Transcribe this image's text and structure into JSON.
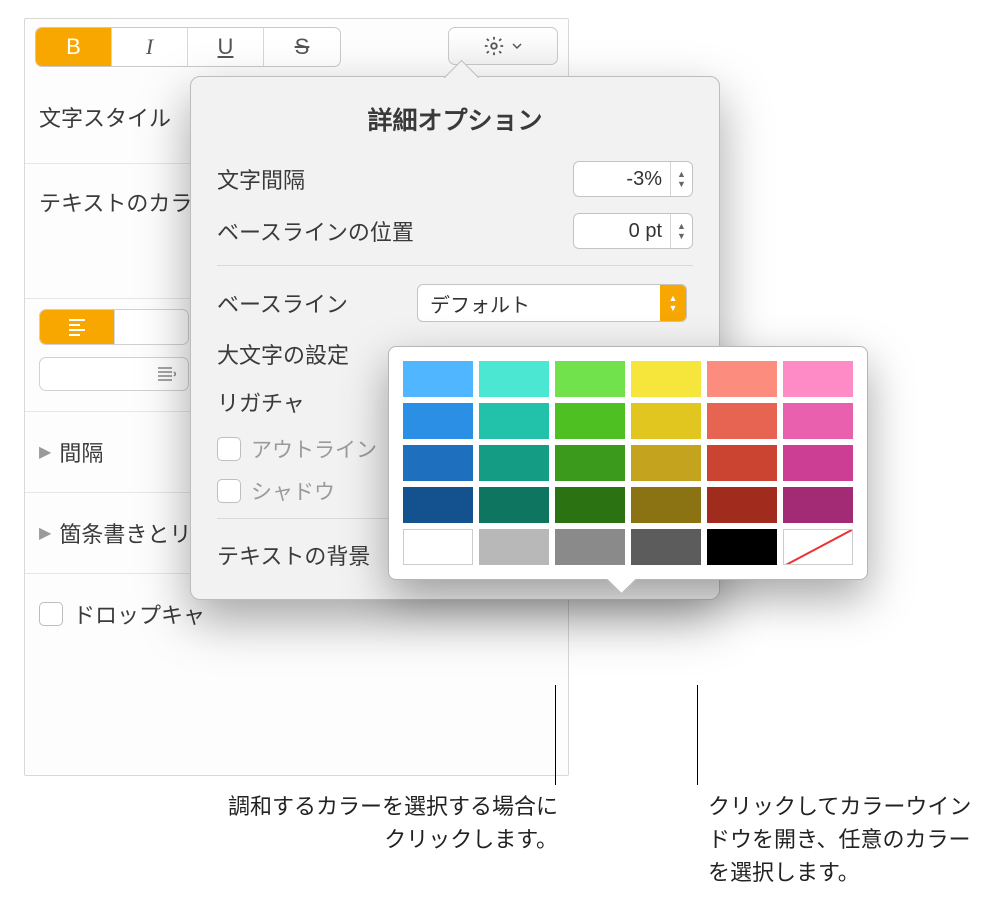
{
  "toolbar": {
    "bold": "B",
    "italic": "I",
    "underline": "U",
    "strike": "S"
  },
  "sidebar": {
    "char_style": "文字スタイル",
    "text_color": "テキストのカラー",
    "spacing": "間隔",
    "bullets": "箇条書きとリ",
    "dropcap": "ドロップキャ"
  },
  "popover": {
    "title": "詳細オプション",
    "char_spacing_label": "文字間隔",
    "char_spacing_value": "-3%",
    "baseline_offset_label": "ベースラインの位置",
    "baseline_offset_value": "0 pt",
    "baseline_label": "ベースライン",
    "baseline_value": "デフォルト",
    "caps_label": "大文字の設定",
    "ligature_label": "リガチャ",
    "outline_label": "アウトライン",
    "shadow_label": "シャドウ",
    "text_bg_label": "テキストの背景"
  },
  "swatches": [
    [
      "#4FB6FF",
      "#4CE7D2",
      "#71E24B",
      "#F6E63B",
      "#FC8C7E",
      "#FE8AC6"
    ],
    [
      "#2B8FE6",
      "#22C1A9",
      "#4EC021",
      "#E0C61E",
      "#E86452",
      "#E860AE"
    ],
    [
      "#1F6FBF",
      "#159C85",
      "#3B991B",
      "#C4A41E",
      "#CB4331",
      "#CB3E93"
    ],
    [
      "#14518F",
      "#0E7561",
      "#2B7312",
      "#8B7213",
      "#A12B1D",
      "#A32A75"
    ]
  ],
  "grays": [
    "#FFFFFF",
    "#B8B8B8",
    "#8A8A8A",
    "#5C5C5C",
    "#000000",
    "none"
  ],
  "callouts": {
    "left": "調和するカラーを選択する場合にクリックします。",
    "right": "クリックしてカラーウインドウを開き、任意のカラーを選択します。"
  }
}
